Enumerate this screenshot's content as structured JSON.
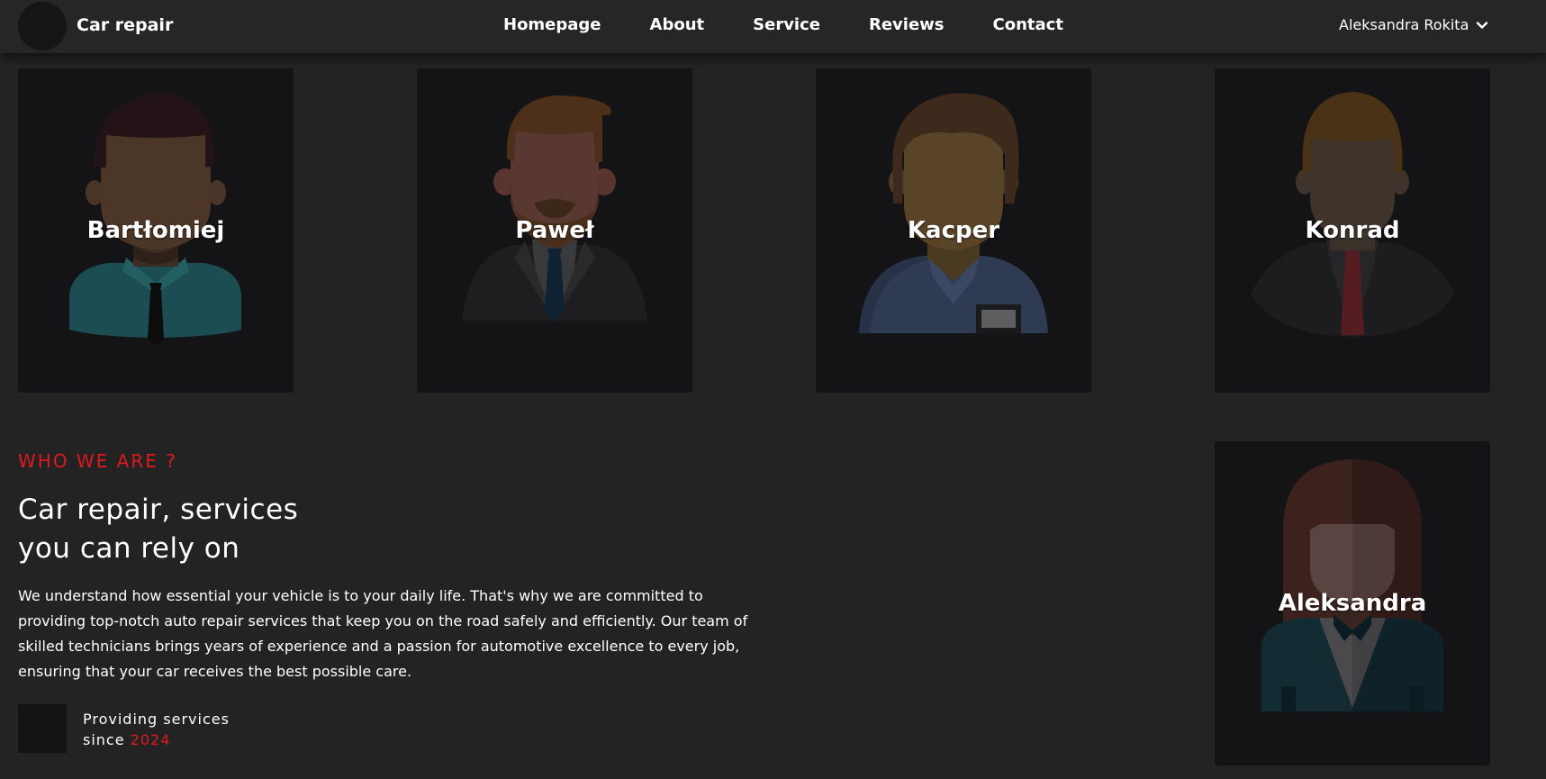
{
  "nav": {
    "brand": "Car repair",
    "links": [
      "Homepage",
      "About",
      "Service",
      "Reviews",
      "Contact"
    ],
    "user": "Aleksandra Rokita"
  },
  "team": [
    {
      "name": "Bartłomiej"
    },
    {
      "name": "Paweł"
    },
    {
      "name": "Kacper"
    },
    {
      "name": "Konrad"
    },
    {
      "name": "Aleksandra"
    }
  ],
  "about": {
    "eyebrow": "WHO WE ARE ?",
    "headline_line1": "Car repair, services",
    "headline_line2": "you can rely on",
    "body": "We understand how essential your vehicle is to your daily life. That's why we are committed to providing top-notch auto repair services that keep you on the road safely and efficiently. Our team of skilled technicians brings years of experience and a passion for automotive excellence to every job, ensuring that your car receives the best possible care.",
    "since_label_1": "Providing services",
    "since_label_2": "since",
    "since_year": "2024"
  },
  "colors": {
    "accent": "#e0191e",
    "background": "#232324",
    "card": "#141315",
    "navbar": "#262627"
  },
  "icons": [
    "logo-icon",
    "chevron-down-icon"
  ]
}
